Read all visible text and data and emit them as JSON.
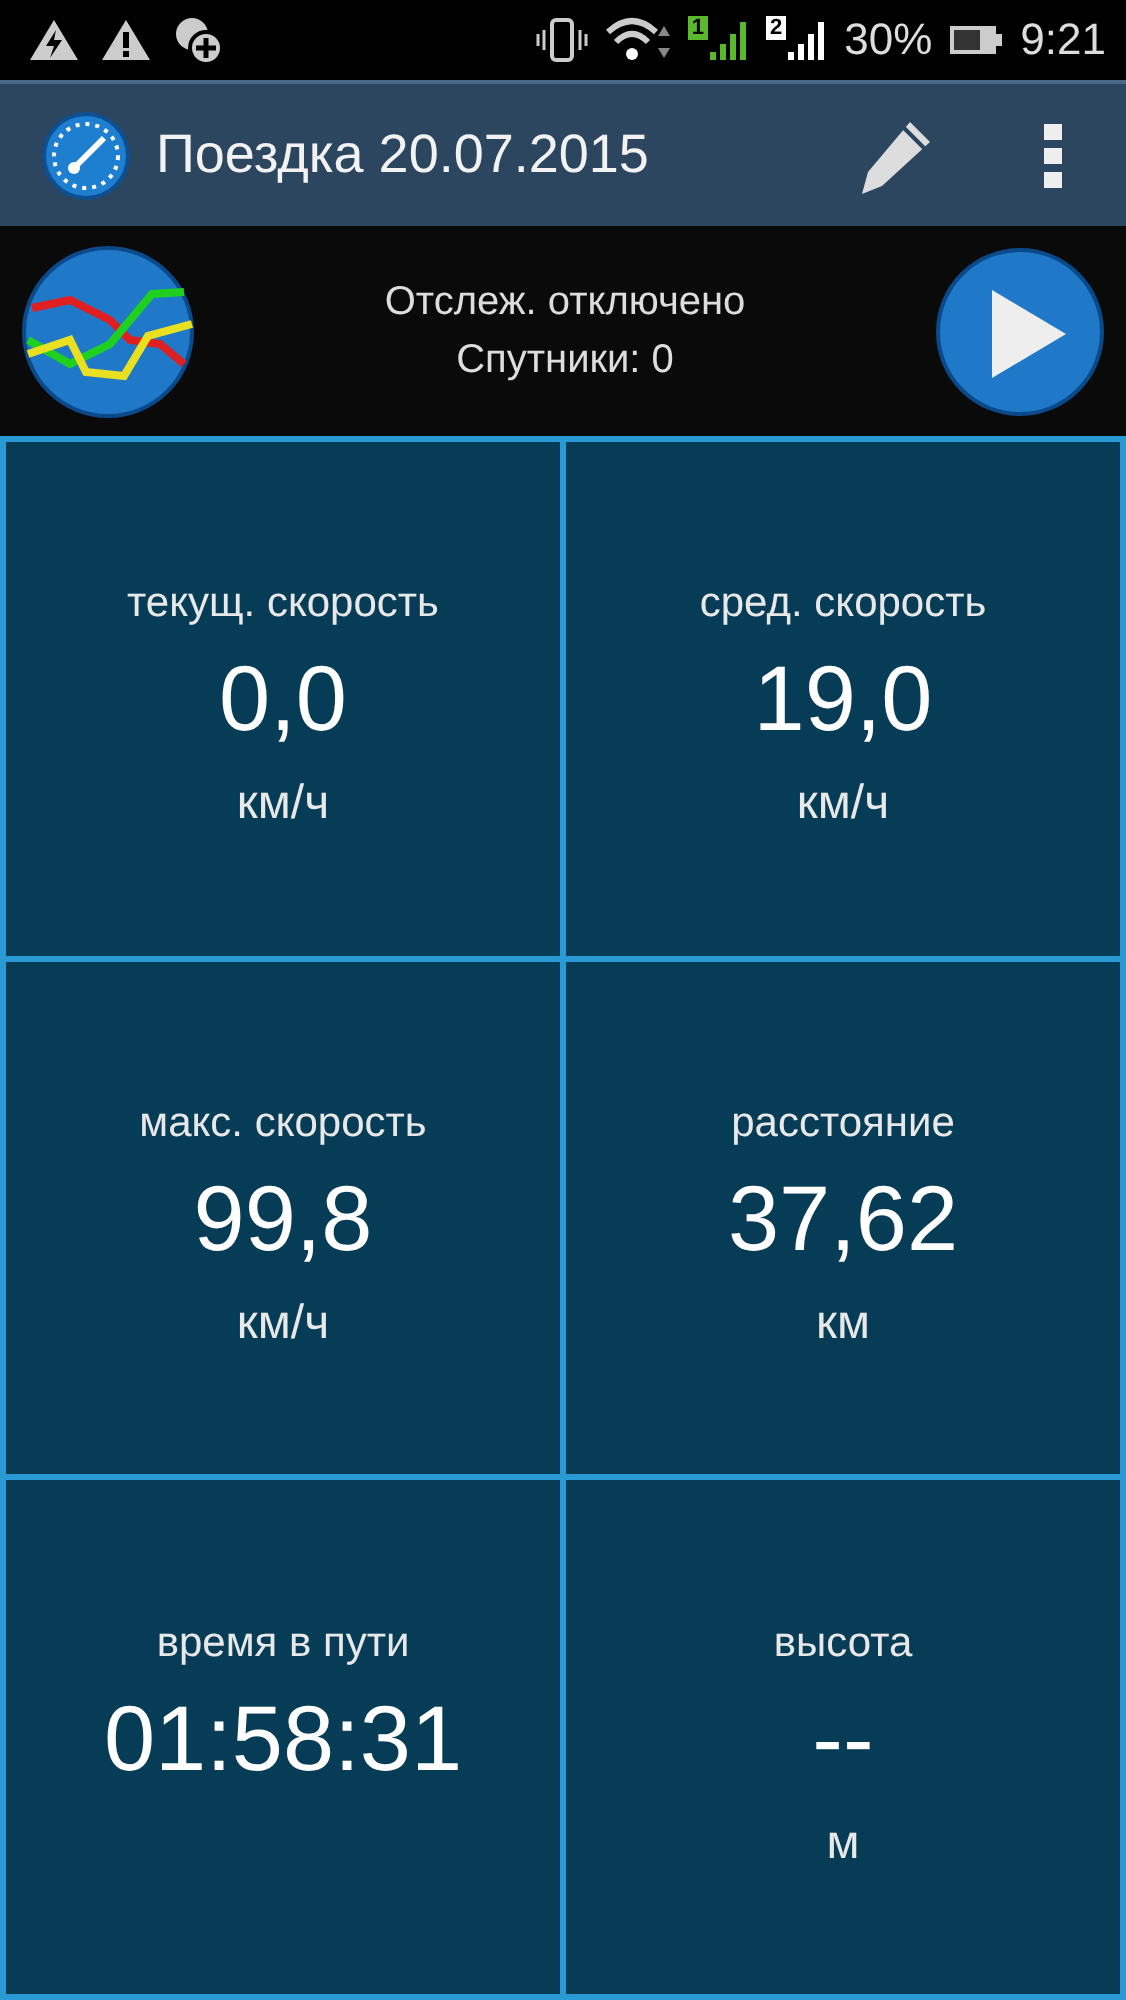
{
  "status_bar": {
    "sims": [
      {
        "label": "1",
        "color": "#5ab82c"
      },
      {
        "label": "2",
        "color": "#ffffff"
      }
    ],
    "battery": "30%",
    "time": "9:21"
  },
  "app_bar": {
    "title": "Поездка 20.07.2015"
  },
  "tracking": {
    "status": "Отслеж. отключено",
    "satellites": "Спутники: 0"
  },
  "tiles": [
    {
      "label": "текущ. скорость",
      "value": "0,0",
      "unit": "км/ч"
    },
    {
      "label": "сред. скорость",
      "value": "19,0",
      "unit": "км/ч"
    },
    {
      "label": "макс. скорость",
      "value": "99,8",
      "unit": "км/ч"
    },
    {
      "label": "расстояние",
      "value": "37,62",
      "unit": "км"
    },
    {
      "label": "время в пути",
      "value": "01:58:31"
    },
    {
      "label": "высота",
      "value": "--",
      "unit": "м"
    }
  ]
}
